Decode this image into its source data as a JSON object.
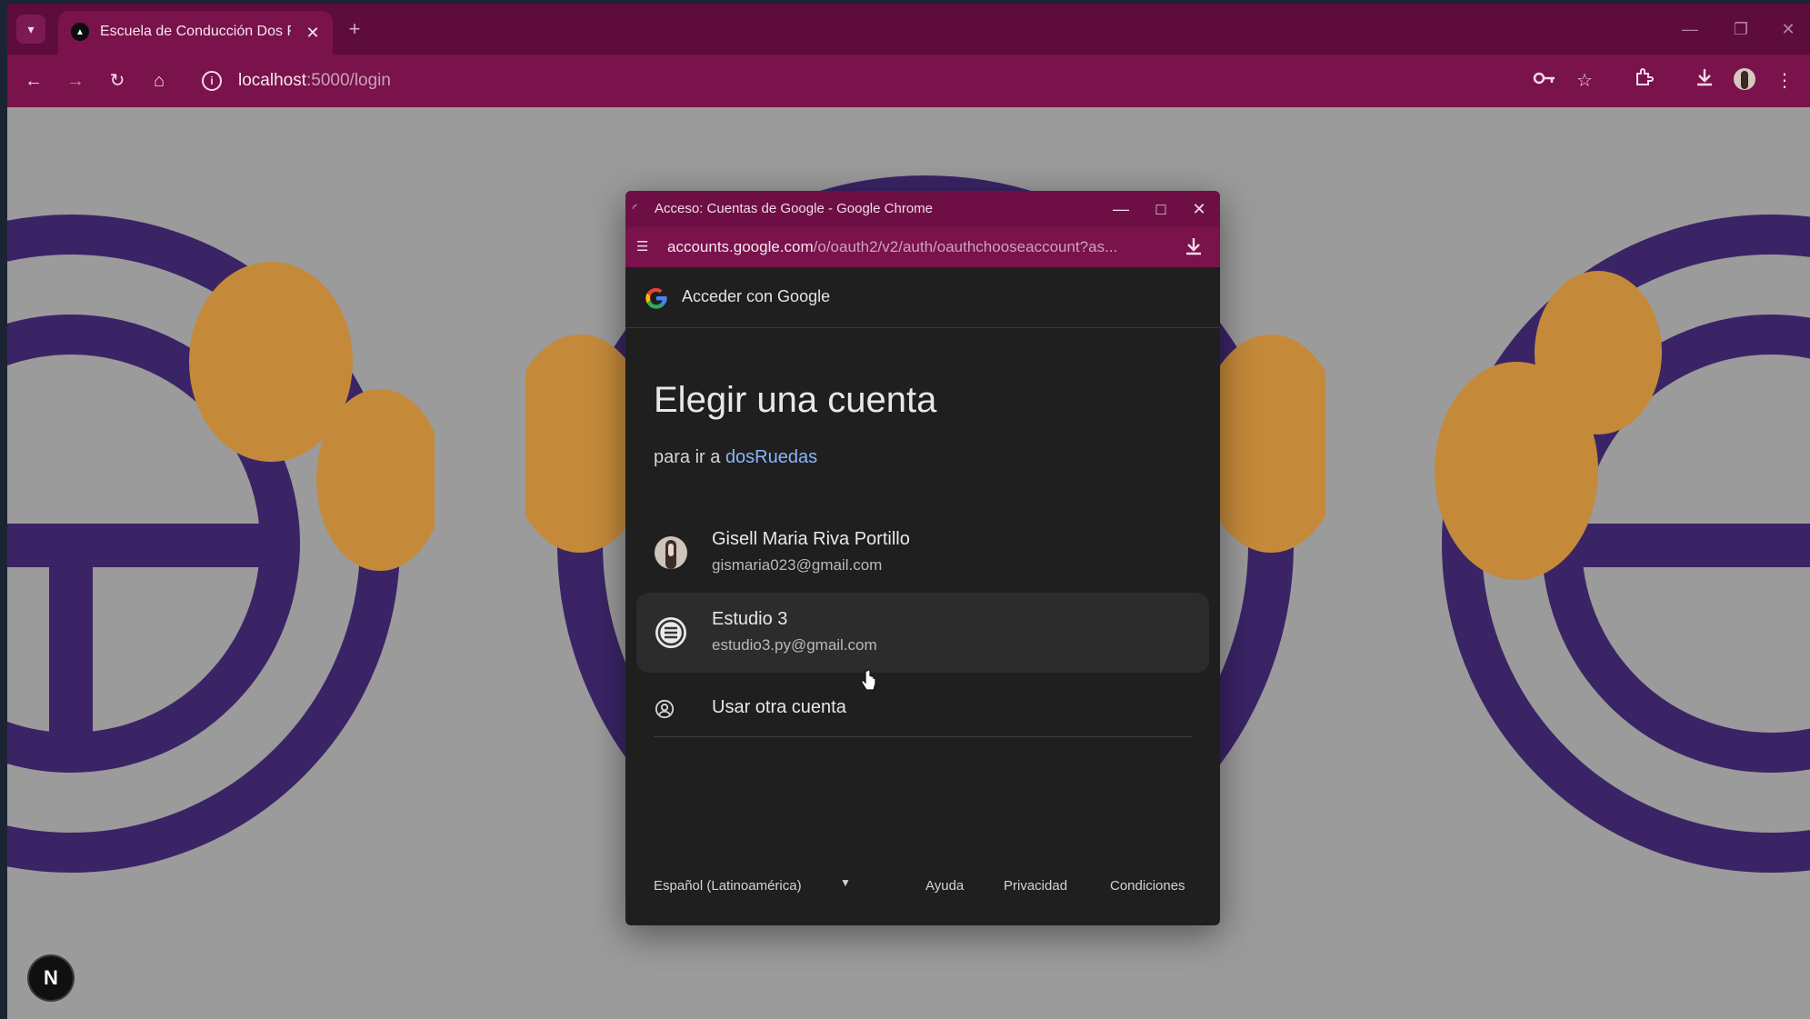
{
  "browser": {
    "tab_title": "Escuela de Conducción Dos Ruedas",
    "url_host": "localhost",
    "url_path": ":5000/login"
  },
  "popup": {
    "window_title": "Acceso: Cuentas de Google - Google Chrome",
    "url_host": "accounts.google.com",
    "url_path": "/o/oauth2/v2/auth/oauthchooseaccount?as...",
    "header": "Acceder con Google",
    "heading": "Elegir una cuenta",
    "subheading_prefix": "para ir a",
    "subheading_app": "dosRuedas",
    "accounts": [
      {
        "name": "Gisell Maria Riva Portillo",
        "email": "gismaria023@gmail.com"
      },
      {
        "name": "Estudio 3",
        "email": "estudio3.py@gmail.com"
      }
    ],
    "other_account": "Usar otra cuenta",
    "footer": {
      "language": "Español (Latinoamérica)",
      "help": "Ayuda",
      "privacy": "Privacidad",
      "terms": "Condiciones"
    }
  },
  "page": {
    "badge": "N"
  },
  "colors": {
    "tabbar": "#5e0c3b",
    "toolbar": "#7a124c",
    "logo_purple": "#3a2466",
    "logo_gold": "#c48a3a",
    "link_blue": "#8ab4f8"
  }
}
